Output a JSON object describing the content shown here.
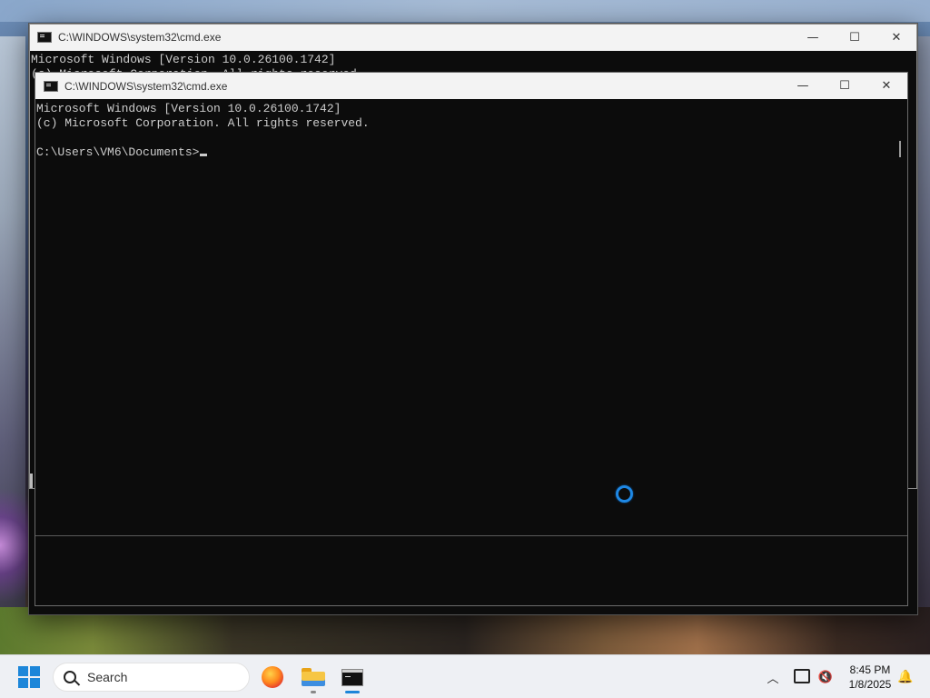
{
  "back_window": {
    "title": "C:\\WINDOWS\\system32\\cmd.exe",
    "console_line1": "Microsoft Windows [Version 10.0.26100.1742]",
    "console_line2": "(c) Microsoft Corporation. All rights reserved.",
    "minimize_glyph": "—",
    "maximize_glyph": "☐",
    "close_glyph": "✕"
  },
  "front_window": {
    "title": "C:\\WINDOWS\\system32\\cmd.exe",
    "console_line1": "Microsoft Windows [Version 10.0.26100.1742]",
    "console_line2": "(c) Microsoft Corporation. All rights reserved.",
    "prompt": "C:\\Users\\VM6\\Documents>",
    "minimize_glyph": "—",
    "maximize_glyph": "☐",
    "close_glyph": "✕"
  },
  "taskbar": {
    "search_label": "Search",
    "pinned_apps": [
      "firefox-icon",
      "file-explorer-icon",
      "command-prompt-icon"
    ],
    "tray": {
      "chevron_glyph": "︿",
      "volume_glyph": "🔇",
      "bell_glyph": "🔔"
    },
    "clock": {
      "time": "8:45 PM",
      "date": "1/8/2025"
    }
  },
  "colors": {
    "accent": "#1c86d9",
    "console_bg": "#0c0c0c",
    "console_text": "#cccccc",
    "titlebar_bg": "#f3f3f3",
    "taskbar_bg": "#eef0f4"
  }
}
